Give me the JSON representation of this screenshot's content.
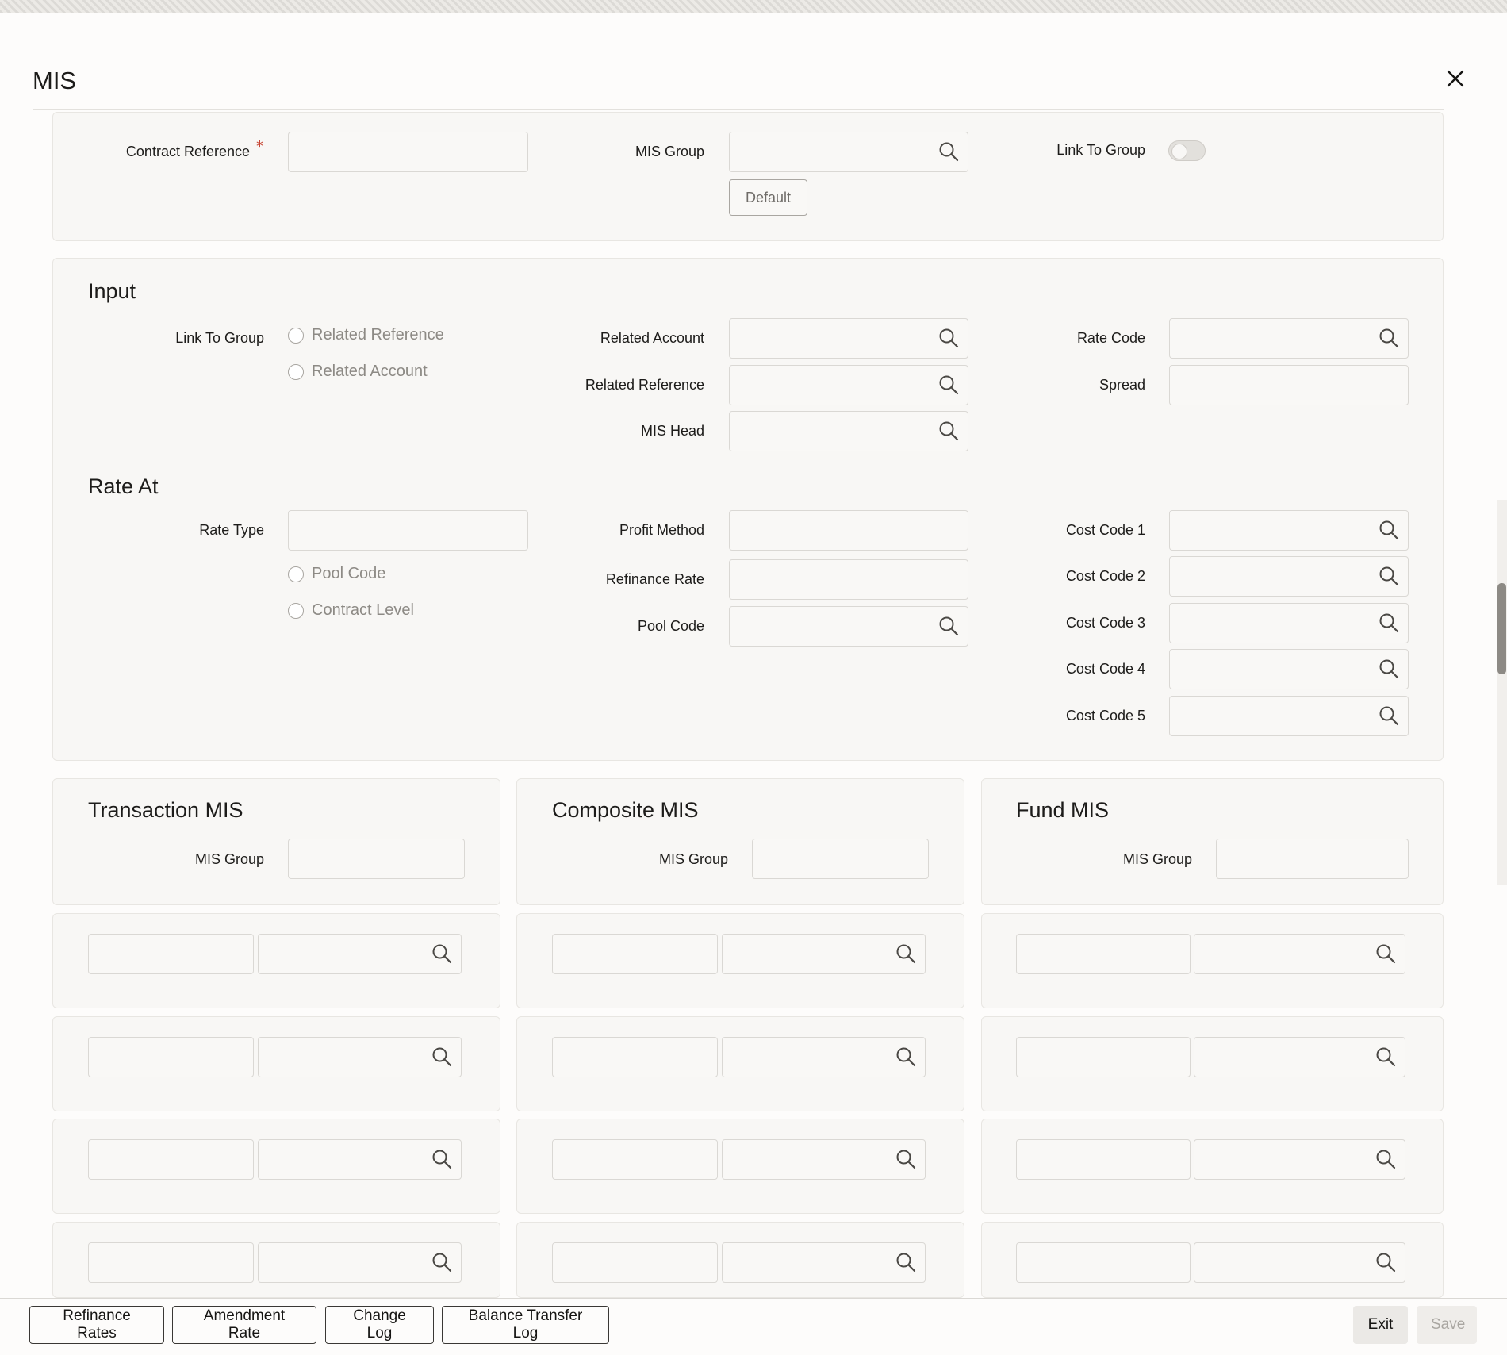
{
  "title": "MIS",
  "header_section": {
    "contract_reference_label": "Contract Reference",
    "required_marker": "*",
    "contract_reference_value": "",
    "mis_group_label": "MIS Group",
    "mis_group_value": "",
    "link_to_group_label": "Link To Group",
    "link_to_group_on": false,
    "default_button": "Default"
  },
  "input_section": {
    "title": "Input",
    "link_to_group_label": "Link To Group",
    "radio_related_reference": "Related Reference",
    "radio_related_account": "Related Account",
    "related_account_label": "Related Account",
    "related_reference_label": "Related Reference",
    "mis_head_label": "MIS Head",
    "rate_code_label": "Rate Code",
    "spread_label": "Spread"
  },
  "rate_at_section": {
    "title": "Rate At",
    "rate_type_label": "Rate Type",
    "radio_pool_code": "Pool Code",
    "radio_contract_level": "Contract Level",
    "profit_method_label": "Profit Method",
    "refinance_rate_label": "Refinance Rate",
    "pool_code_label": "Pool Code",
    "cost_code_1_label": "Cost Code 1",
    "cost_code_2_label": "Cost Code 2",
    "cost_code_3_label": "Cost Code 3",
    "cost_code_4_label": "Cost Code 4",
    "cost_code_5_label": "Cost Code 5"
  },
  "transaction_mis": {
    "title": "Transaction MIS",
    "mis_group_label": "MIS Group"
  },
  "composite_mis": {
    "title": "Composite MIS",
    "mis_group_label": "MIS Group"
  },
  "fund_mis": {
    "title": "Fund MIS",
    "mis_group_label": "MIS Group"
  },
  "footer": {
    "refinance_rates": "Refinance Rates",
    "amendment_rate": "Amendment Rate",
    "change_log": "Change Log",
    "balance_transfer_log": "Balance Transfer Log",
    "exit": "Exit",
    "save": "Save"
  },
  "colors": {
    "background": "#fdfcfb",
    "panel": "#f8f7f5",
    "border": "#dad8d4",
    "required": "#c74634"
  },
  "icons": [
    "close-icon",
    "search-icon"
  ]
}
